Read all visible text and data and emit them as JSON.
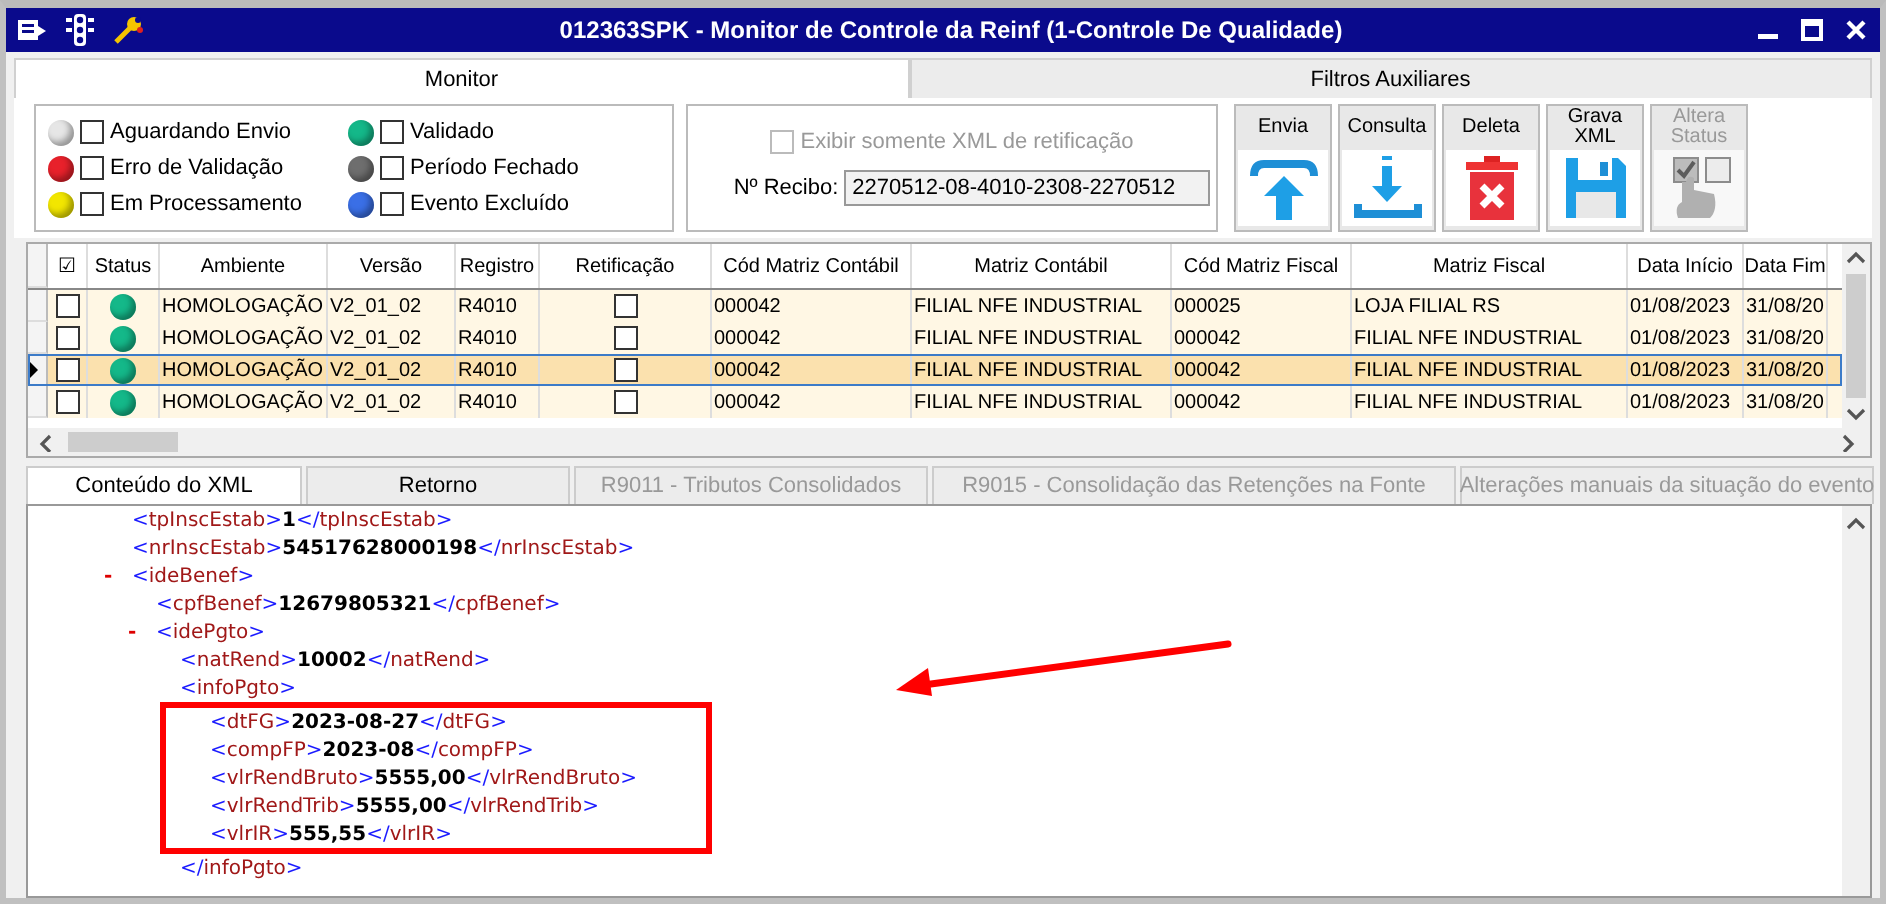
{
  "window": {
    "title": "012363SPK - Monitor de Controle da Reinf (1-Controle De Qualidade)"
  },
  "tabs": [
    {
      "label": "Monitor",
      "selected": true
    },
    {
      "label": "Filtros Auxiliares",
      "selected": false
    }
  ],
  "legend": [
    {
      "label": "Aguardando Envio",
      "color": "#e6e6e6",
      "checked": false
    },
    {
      "label": "Erro de Validação",
      "color": "#e8212b",
      "checked": false
    },
    {
      "label": "Em Processamento",
      "color": "#f2e600",
      "checked": false
    },
    {
      "label": "Validado",
      "color": "#14b889",
      "checked": false
    },
    {
      "label": "Período Fechado",
      "color": "#6e6e6e",
      "checked": false
    },
    {
      "label": "Evento Excluído",
      "color": "#3a6fe6",
      "checked": false
    }
  ],
  "filter": {
    "retification_only": {
      "label": "Exibir somente XML de retificação",
      "checked": false,
      "disabled": true
    },
    "receipt": {
      "label": "Nº Recibo:",
      "value": "2270512-08-4010-2308-2270512"
    }
  },
  "actions": [
    {
      "label": "Envia",
      "kind": "upload",
      "disabled": false
    },
    {
      "label": "Consulta",
      "kind": "download",
      "disabled": false
    },
    {
      "label": "Deleta",
      "kind": "delete",
      "disabled": false
    },
    {
      "label": "Grava XML",
      "kind": "save",
      "disabled": false
    },
    {
      "label": "Altera Status",
      "kind": "status",
      "disabled": true
    }
  ],
  "table": {
    "columns": [
      "☑",
      "Status",
      "Ambiente",
      "Versão",
      "Registro",
      "Retificação",
      "Cód Matriz Contábil",
      "Matriz Contábil",
      "Cód Matriz Fiscal",
      "Matriz Fiscal",
      "Data Início",
      "Data Fim"
    ],
    "rows": [
      {
        "selected": false,
        "cells": [
          {
            "kind": "checkbox",
            "checked": false
          },
          {
            "kind": "status",
            "color": "#14b889"
          },
          {
            "kind": "text",
            "text": "HOMOLOGAÇÃO"
          },
          {
            "kind": "text",
            "text": "V2_01_02"
          },
          {
            "kind": "text",
            "text": "R4010"
          },
          {
            "kind": "checkbox",
            "checked": false
          },
          {
            "kind": "text",
            "text": "000042"
          },
          {
            "kind": "text",
            "text": "FILIAL NFE INDUSTRIAL"
          },
          {
            "kind": "text",
            "text": "000025"
          },
          {
            "kind": "text",
            "text": "LOJA FILIAL RS"
          },
          {
            "kind": "text",
            "text": "01/08/2023"
          },
          {
            "kind": "text",
            "text": "31/08/20"
          }
        ]
      },
      {
        "selected": false,
        "cells": [
          {
            "kind": "checkbox",
            "checked": false
          },
          {
            "kind": "status",
            "color": "#14b889"
          },
          {
            "kind": "text",
            "text": "HOMOLOGAÇÃO"
          },
          {
            "kind": "text",
            "text": "V2_01_02"
          },
          {
            "kind": "text",
            "text": "R4010"
          },
          {
            "kind": "checkbox",
            "checked": false
          },
          {
            "kind": "text",
            "text": "000042"
          },
          {
            "kind": "text",
            "text": "FILIAL NFE INDUSTRIAL"
          },
          {
            "kind": "text",
            "text": "000042"
          },
          {
            "kind": "text",
            "text": "FILIAL NFE INDUSTRIAL"
          },
          {
            "kind": "text",
            "text": "01/08/2023"
          },
          {
            "kind": "text",
            "text": "31/08/20"
          }
        ]
      },
      {
        "selected": true,
        "cells": [
          {
            "kind": "checkbox",
            "checked": false
          },
          {
            "kind": "status",
            "color": "#14b889"
          },
          {
            "kind": "text",
            "text": "HOMOLOGAÇÃO"
          },
          {
            "kind": "text",
            "text": "V2_01_02"
          },
          {
            "kind": "text",
            "text": "R4010"
          },
          {
            "kind": "checkbox",
            "checked": false
          },
          {
            "kind": "text",
            "text": "000042"
          },
          {
            "kind": "text",
            "text": "FILIAL NFE INDUSTRIAL"
          },
          {
            "kind": "text",
            "text": "000042"
          },
          {
            "kind": "text",
            "text": "FILIAL NFE INDUSTRIAL"
          },
          {
            "kind": "text",
            "text": "01/08/2023"
          },
          {
            "kind": "text",
            "text": "31/08/20"
          }
        ]
      },
      {
        "selected": false,
        "cells": [
          {
            "kind": "checkbox",
            "checked": false
          },
          {
            "kind": "status",
            "color": "#14b889"
          },
          {
            "kind": "text",
            "text": "HOMOLOGAÇÃO"
          },
          {
            "kind": "text",
            "text": "V2_01_02"
          },
          {
            "kind": "text",
            "text": "R4010"
          },
          {
            "kind": "checkbox",
            "checked": false
          },
          {
            "kind": "text",
            "text": "000042"
          },
          {
            "kind": "text",
            "text": "FILIAL NFE INDUSTRIAL"
          },
          {
            "kind": "text",
            "text": "000042"
          },
          {
            "kind": "text",
            "text": "FILIAL NFE INDUSTRIAL"
          },
          {
            "kind": "text",
            "text": "01/08/2023"
          },
          {
            "kind": "text",
            "text": "31/08/20"
          }
        ]
      }
    ]
  },
  "detail_tabs": [
    {
      "label": "Conteúdo do XML",
      "selected": true,
      "disabled": false
    },
    {
      "label": "Retorno",
      "selected": false,
      "disabled": false
    },
    {
      "label": "R9011 - Tributos Consolidados",
      "selected": false,
      "disabled": true
    },
    {
      "label": "R9015 - Consolidação das Retenções na Fonte",
      "selected": false,
      "disabled": true
    },
    {
      "label": "Alterações manuais da situação do evento",
      "selected": false,
      "disabled": true
    }
  ],
  "xml": [
    {
      "open": "<tpInscEstab>",
      "value": "1",
      "close": "</tpInscEstab>"
    },
    {
      "open": "<nrInscEstab>",
      "value": "54517628000198",
      "close": "</nrInscEstab>"
    },
    {
      "open": "<ideBenef>",
      "toggle": "-",
      "children": [
        {
          "open": "<cpfBenef>",
          "value": "12679805321",
          "close": "</cpfBenef>"
        },
        {
          "open": "<idePgto>",
          "toggle": "-",
          "children": [
            {
              "open": "<natRend>",
              "value": "10002",
              "close": "</natRend>"
            },
            {
              "open": "<infoPgto>",
              "close": "</infoPgto>",
              "highlighted": true,
              "children": [
                {
                  "open": "<dtFG>",
                  "value": "2023-08-27",
                  "close": "</dtFG>"
                },
                {
                  "open": "<compFP>",
                  "value": "2023-08",
                  "close": "</compFP>"
                },
                {
                  "open": "<vlrRendBruto>",
                  "value": "5555,00",
                  "close": "</vlrRendBruto>"
                },
                {
                  "open": "<vlrRendTrib>",
                  "value": "5555,00",
                  "close": "</vlrRendTrib>"
                },
                {
                  "open": "<vlrIR>",
                  "value": "555,55",
                  "close": "</vlrIR>"
                }
              ]
            }
          ]
        }
      ]
    }
  ]
}
